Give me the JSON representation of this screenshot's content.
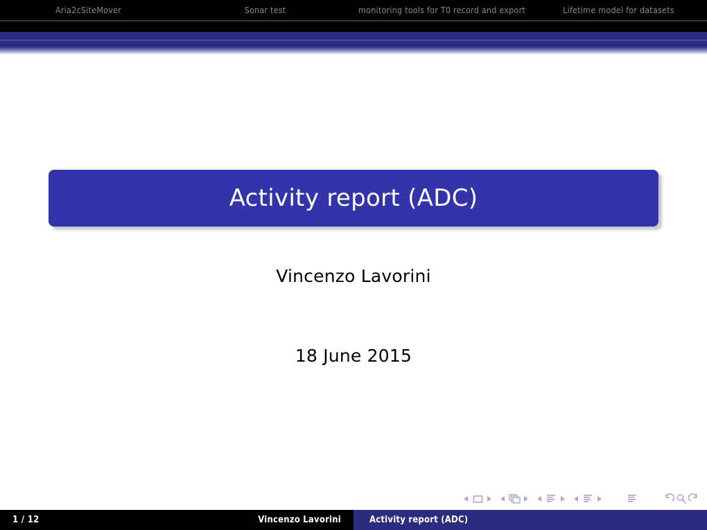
{
  "slide": {
    "title": "Activity report (ADC)",
    "author": "Vincenzo Lavorini",
    "date": "18 June 2015",
    "page_indicator": "1 / 12"
  },
  "navbar": {
    "sections": [
      {
        "label": "Aria2cSiteMover"
      },
      {
        "label": "Sonar test"
      },
      {
        "label": "monitoring tools for T0 record and export"
      },
      {
        "label": "Lifetime model for datasets"
      }
    ]
  },
  "navigation_symbols": {
    "groups": [
      {
        "name": "slide-navigation",
        "prev_label": "Previous slide",
        "icon": "slide-icon",
        "next_label": "Next slide"
      },
      {
        "name": "frame-navigation",
        "prev_label": "Previous frame",
        "icon": "frames-icon",
        "next_label": "Next frame"
      },
      {
        "name": "subsection-navigation",
        "prev_label": "Previous subsection",
        "icon": "subsection-icon",
        "next_label": "Next subsection"
      },
      {
        "name": "section-navigation",
        "prev_label": "Previous section",
        "icon": "section-icon",
        "next_label": "Next section"
      },
      {
        "name": "document-navigation",
        "icon": "document-icon"
      },
      {
        "name": "back-find-forward",
        "back_icon": "back-arrow-icon",
        "find_icon": "search-icon",
        "forward_icon": "forward-arrow-icon"
      }
    ]
  },
  "footer": {
    "page": "1 / 12",
    "author": "Vincenzo Lavorini",
    "title": "Activity report (ADC)"
  },
  "colors": {
    "header_black": "#000000",
    "header_blue": "#2b2b7f",
    "title_box_blue": "#3333aa",
    "nav_symbol": "#a9a9d6",
    "nav_text_gray": "#888888",
    "white": "#ffffff"
  }
}
